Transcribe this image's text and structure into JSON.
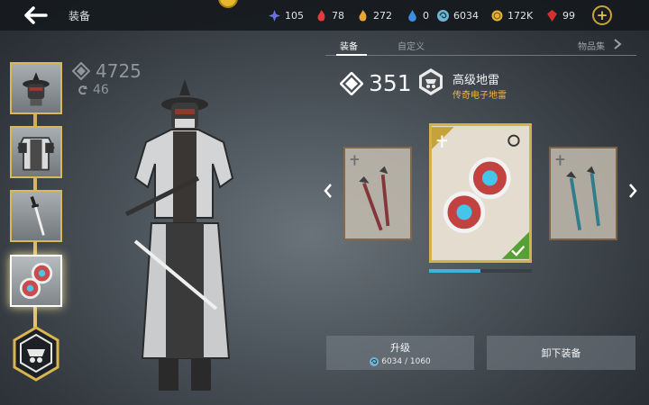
{
  "header": {
    "title": "装备",
    "currencies": [
      {
        "icon": "gem-blue-star-icon",
        "value": "105",
        "color": "#6a6fe6"
      },
      {
        "icon": "red-flame-icon",
        "value": "78",
        "color": "#e23b3b"
      },
      {
        "icon": "gold-flame-icon",
        "value": "272",
        "color": "#e9a53a"
      },
      {
        "icon": "blue-drop-icon",
        "value": "0",
        "color": "#3a8fe3"
      },
      {
        "icon": "swirl-icon",
        "value": "6034",
        "color": "#6fb6d6"
      },
      {
        "icon": "gold-coin-icon",
        "value": "172K",
        "color": "#e1b23b"
      },
      {
        "icon": "ruby-icon",
        "value": "99",
        "color": "#d7302c"
      }
    ]
  },
  "left": {
    "power_value": "4725",
    "level_value": "46"
  },
  "tabs": [
    {
      "label": "装备"
    },
    {
      "label": "自定义"
    },
    {
      "label": "物品集"
    }
  ],
  "item": {
    "score": "351",
    "name": "高级地雷",
    "subtitle": "传奇电子地雷",
    "icon": "mask-badge-icon"
  },
  "progress_fraction": 0.5,
  "buttons": {
    "upgrade_label": "升级",
    "upgrade_cost": "6034 / 1060",
    "unequip_label": "卸下装备"
  },
  "colors": {
    "accent_gold": "#d4b24a",
    "subtitle_orange": "#f0b640",
    "progress_blue": "#3fb4d6"
  }
}
